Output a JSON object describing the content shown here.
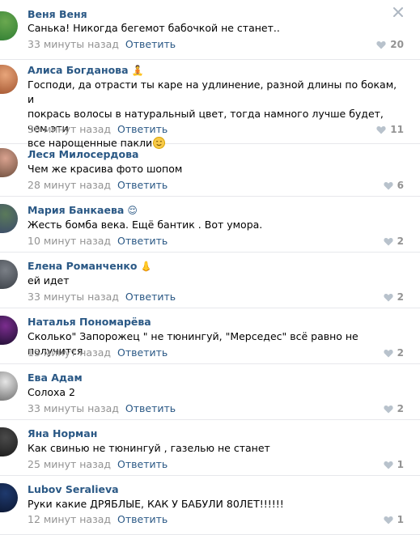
{
  "comments": [
    {
      "author": "Веня Веня",
      "text": "Санька! Никогда бегемот бабочкой не станет..",
      "time": "33 минуты назад",
      "reply": "Ответить",
      "likes": "20",
      "avatar_colors": [
        "#6aa84f",
        "#2e7d32"
      ]
    },
    {
      "author": "Алиса Богданова",
      "author_emoji": "🧘",
      "text": "Господи, да отрасти ты каре на удлинение, разной длины по бокам, и\nпокрась волосы в натуральный цвет, тогда намного лучше будет, чем эти\nвсе нарощенные пакли",
      "text_emoji": "smiley-icon",
      "time": "30 минут назад",
      "reply": "Ответить",
      "likes": "11",
      "avatar_colors": [
        "#e8a57a",
        "#a0522d"
      ]
    },
    {
      "author": "Леся Милосердова",
      "text": "Чем же красива фото шопом",
      "time": "28 минут назад",
      "reply": "Ответить",
      "likes": "6",
      "avatar_colors": [
        "#d9a28f",
        "#6b4c3b"
      ]
    },
    {
      "author": "Мария Банкаева",
      "author_emoji": "😌",
      "text": "Жесть бомба века. Ещё бантик . Вот умора.",
      "time": "10 минут назад",
      "reply": "Ответить",
      "likes": "2",
      "avatar_colors": [
        "#5a7a5a",
        "#3b4a6b"
      ]
    },
    {
      "author": "Елена Романченко",
      "author_emoji": "👃",
      "text": "ей идет",
      "time": "33 минуты назад",
      "reply": "Ответить",
      "likes": "2",
      "avatar_colors": [
        "#7a7f86",
        "#3a3f46"
      ]
    },
    {
      "author": "Наталья Пономарёва",
      "text": "Сколько\" Запорожец \" не тюнингуй, \"Мерседес\" всё равно не получится",
      "time": "15 минут назад",
      "reply": "Ответить",
      "likes": "2",
      "avatar_colors": [
        "#7b2d8e",
        "#1a0d2e"
      ]
    },
    {
      "author": "Ева Адам",
      "text": "Солоха 2",
      "time": "33 минуты назад",
      "reply": "Ответить",
      "likes": "2",
      "avatar_colors": [
        "#e6e6e6",
        "#6b6b6b"
      ]
    },
    {
      "author": "Яна Норман",
      "text": "Как свинью не тюнингуй , газелью не станет",
      "time": "25 минут назад",
      "reply": "Ответить",
      "likes": "1",
      "avatar_colors": [
        "#4a4a4a",
        "#1a1a1a"
      ]
    },
    {
      "author": "Lubov Seralieva",
      "text": "Руки какие ДРЯБЛЫЕ, КАК У БАБУЛИ 80ЛЕТ!!!!!!",
      "time": "12 минут назад",
      "reply": "Ответить",
      "likes": "1",
      "avatar_colors": [
        "#1f3a6e",
        "#0b1630"
      ]
    }
  ],
  "close_icon": "close-icon",
  "like_icon": "heart-icon",
  "colors": {
    "link": "#2a5885",
    "muted": "#939393",
    "divider": "#e7e8ec"
  }
}
